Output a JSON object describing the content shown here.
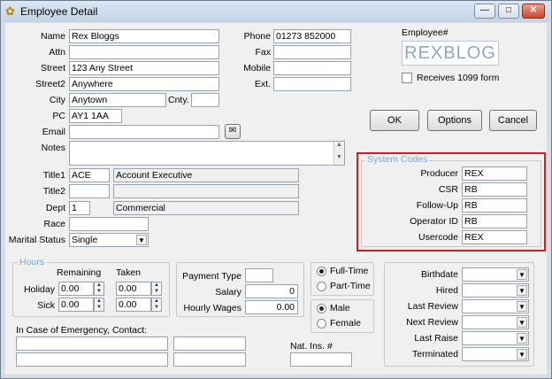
{
  "window": {
    "title": "Employee Detail",
    "minimize": "—",
    "maximize": "□",
    "close": "✕"
  },
  "personal": {
    "name_label": "Name",
    "name": "Rex Bloggs",
    "attn_label": "Attn",
    "attn": "",
    "street_label": "Street",
    "street": "123 Any Street",
    "street2_label": "Street2",
    "street2": "Anywhere",
    "city_label": "City",
    "city": "Anytown",
    "cnty_label": "Cnty.",
    "cnty": "",
    "pc_label": "PC",
    "pc": "AY1 1AA",
    "email_label": "Email",
    "email": "",
    "notes_label": "Notes",
    "notes": "",
    "title1_label": "Title1",
    "title1_code": "ACE",
    "title1_desc": "Account Executive",
    "title2_label": "Title2",
    "title2_code": "",
    "title2_desc": "",
    "dept_label": "Dept",
    "dept_code": "1",
    "dept_desc": "Commercial",
    "race_label": "Race",
    "race": "",
    "marital_label": "Marital Status",
    "marital": "Single"
  },
  "contact": {
    "phone_label": "Phone",
    "phone": "01273 852000",
    "fax_label": "Fax",
    "fax": "",
    "mobile_label": "Mobile",
    "mobile": "",
    "ext_label": "Ext.",
    "ext": ""
  },
  "employee": {
    "label": "Employee#",
    "code": "REXBLOG",
    "receives_1099": "Receives 1099 form"
  },
  "buttons": {
    "ok": "OK",
    "options": "Options",
    "cancel": "Cancel"
  },
  "system_codes": {
    "title": "System Codes",
    "producer_label": "Producer",
    "producer": "REX",
    "csr_label": "CSR",
    "csr": "RB",
    "followup_label": "Follow-Up",
    "followup": "RB",
    "operator_label": "Operator ID",
    "operator": "RB",
    "usercode_label": "Usercode",
    "usercode": "REX"
  },
  "hours": {
    "title": "Hours",
    "remaining_label": "Remaining",
    "taken_label": "Taken",
    "holiday_label": "Holiday",
    "holiday_remaining": "0.00",
    "holiday_taken": "0.00",
    "sick_label": "Sick",
    "sick_remaining": "0.00",
    "sick_taken": "0.00"
  },
  "payment": {
    "type_label": "Payment Type",
    "type": "",
    "salary_label": "Salary",
    "salary": "0",
    "hourly_label": "Hourly Wages",
    "hourly": "0.00"
  },
  "status": {
    "fulltime": "Full-Time",
    "parttime": "Part-Time",
    "male": "Male",
    "female": "Female"
  },
  "dates": {
    "birthdate_label": "Birthdate",
    "hired_label": "Hired",
    "last_review_label": "Last Review",
    "next_review_label": "Next Review",
    "last_raise_label": "Last Raise",
    "terminated_label": "Terminated"
  },
  "emergency": {
    "label": "In Case of Emergency, Contact:",
    "natins_label": "Nat. Ins. #"
  },
  "icons": {
    "app": "app-icon",
    "email_action": "email-send-icon"
  }
}
